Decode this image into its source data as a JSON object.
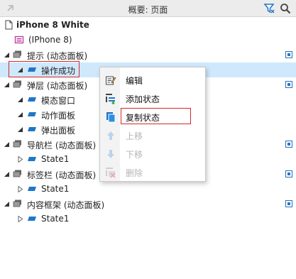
{
  "header": {
    "title": "概要: 页面",
    "collapse_icon": "collapse-arrow-icon",
    "filter_icon": "filter-icon",
    "search_icon": "search-icon"
  },
  "tree": {
    "root": "iPhone 8 White",
    "page_item": "(IPhone 8)",
    "items": [
      {
        "label": "提示 (动态面板)"
      },
      {
        "label": "操作成功"
      },
      {
        "label": "弹层 (动态面板)"
      },
      {
        "label": "模态窗口"
      },
      {
        "label": "动作面板"
      },
      {
        "label": "弹出面板"
      },
      {
        "label": "导航栏 (动态面板)"
      },
      {
        "label": "State1"
      },
      {
        "label": "标签栏 (动态面板)"
      },
      {
        "label": "State1"
      },
      {
        "label": "内容框架 (动态面板)"
      },
      {
        "label": "State1"
      }
    ]
  },
  "context_menu": {
    "items": [
      {
        "label": "编辑",
        "icon": "edit-icon",
        "enabled": true
      },
      {
        "label": "添加状态",
        "icon": "add-state-icon",
        "enabled": true
      },
      {
        "label": "复制状态",
        "icon": "duplicate-state-icon",
        "enabled": true
      },
      {
        "label": "上移",
        "icon": "move-up-icon",
        "enabled": false
      },
      {
        "label": "下移",
        "icon": "move-down-icon",
        "enabled": false
      },
      {
        "label": "删除",
        "icon": "delete-icon",
        "enabled": false
      }
    ]
  },
  "colors": {
    "selection": "#cfe8fb",
    "highlight_box": "#d9252a",
    "state_icon": "#1f77c9",
    "accent": "#2d6db5"
  }
}
